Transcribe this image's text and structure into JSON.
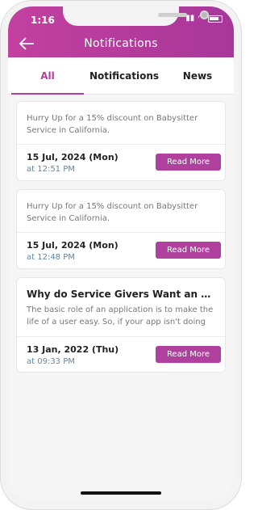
{
  "status_bar": {
    "time": "1:16"
  },
  "header": {
    "title": "Notifications"
  },
  "tabs": [
    {
      "label": "All",
      "active": true
    },
    {
      "label": "Notifications",
      "active": false
    },
    {
      "label": "News",
      "active": false
    }
  ],
  "cards": [
    {
      "message": "Hurry Up for a 15% discount on Babysitter Service in California.",
      "date": "15 Jul, 2024 (Mon)",
      "time": "at 12:51 PM",
      "button": "Read More"
    },
    {
      "message": "Hurry Up for a 15% discount on Babysitter Service in California.",
      "date": "15 Jul, 2024 (Mon)",
      "time": "at 12:48 PM",
      "button": "Read More"
    },
    {
      "heading": "Why do Service Givers Want an App Like th...",
      "message": "The basic role of an application is to make the life of a user easy. So, if your app isn't doing that, you are...",
      "date": "13 Jan, 2022 (Thu)",
      "time": "at 09:33 PM",
      "button": "Read More"
    }
  ],
  "colors": {
    "accent": "#b0409e",
    "header_gradient_start": "#c3409f",
    "time_text": "#5e86a6"
  }
}
